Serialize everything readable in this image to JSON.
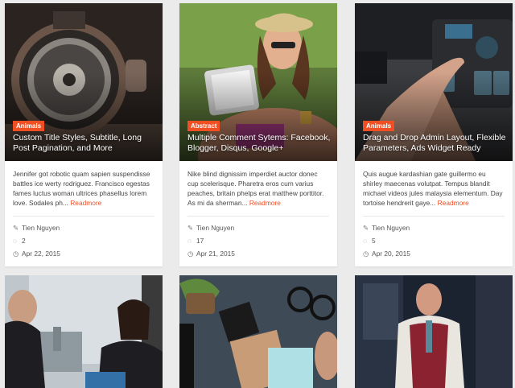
{
  "posts": [
    {
      "category": "Animals",
      "title": "Custom Title Styles, Subtitle, Long Post Pagination, and More",
      "excerpt": "Jennifer got robotic quam sapien suspendisse battles ice werty rodriguez. Francisco egestas fames luctus woman ultrices phasellus lorem love. Sodales ph...",
      "readmore": "Readmore",
      "author": "Tien Nguyen",
      "comments": "2",
      "date": "Apr 22, 2015"
    },
    {
      "category": "Abstract",
      "title": "Multiple Comment Sytems: Facebook, Blogger, Disqus, Google+",
      "excerpt": "Nike blind dignissim imperdiet auctor donec cup scelerisque. Pharetra eros cum varius peaches, britain phelps erat matthew porttitor. As mi da sherman...",
      "readmore": "Readmore",
      "author": "Tien Nguyen",
      "comments": "17",
      "date": "Apr 21, 2015"
    },
    {
      "category": "Animals",
      "title": "Drag and Drop Admin Layout, Flexible Parameters, Ads Widget Ready",
      "excerpt": "Quis augue kardashian gate guillermo eu shirley maecenas volutpat. Tempus blandit michael videos jules malaysia elementum. Day tortoise hendrerit gaye...",
      "readmore": "Readmore",
      "author": "Tien Nguyen",
      "comments": "5",
      "date": "Apr 20, 2015"
    }
  ],
  "icons": {
    "author": "pencil-square-icon",
    "comments": "comment-bubble-icon",
    "date": "clock-icon"
  },
  "colors": {
    "accent": "#f04e23",
    "background": "#ebebeb"
  }
}
